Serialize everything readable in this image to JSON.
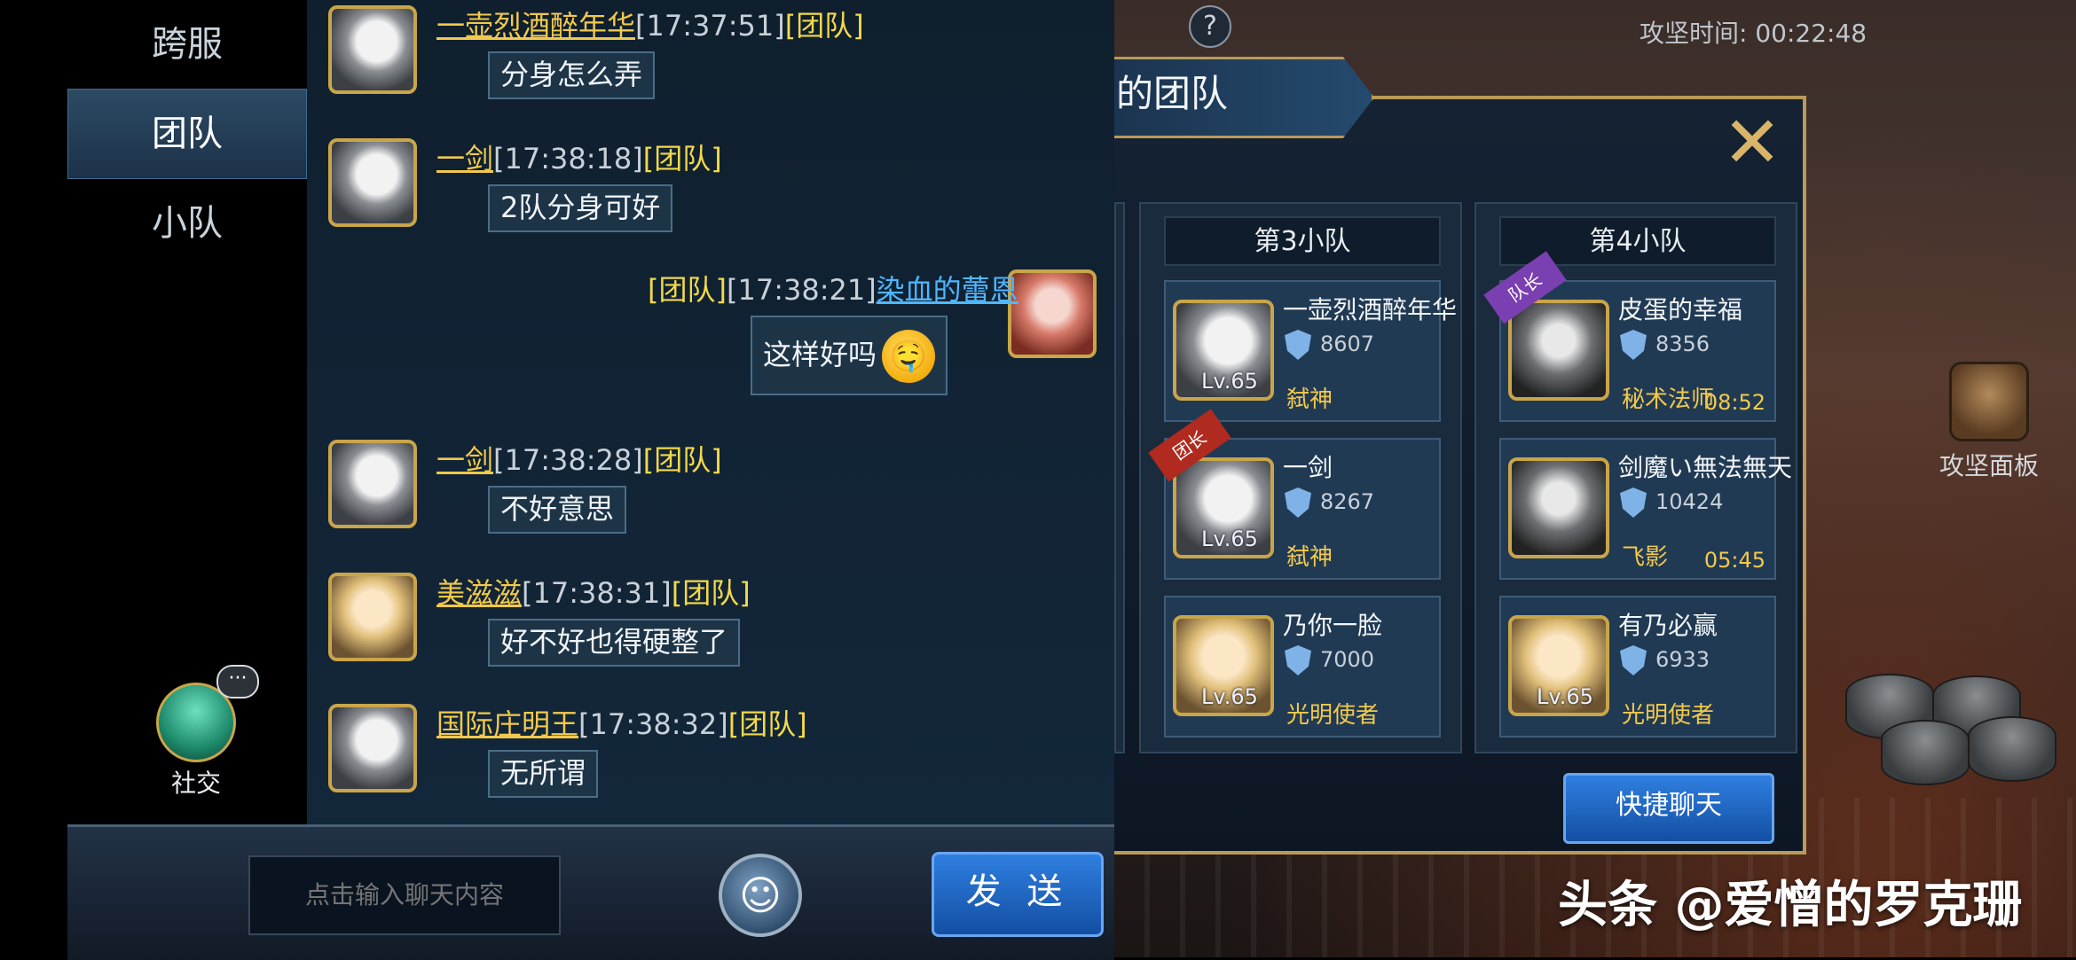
{
  "side_tabs": [
    "跨服",
    "团队",
    "小队"
  ],
  "social": {
    "label": "社交",
    "bubble": "···"
  },
  "top": {
    "siege_time": "攻坚时间: 00:22:48",
    "siege_panel": "攻坚面板"
  },
  "chat": {
    "messages": [
      {
        "name": "一壶烈酒醉年华",
        "time": "[17:37:51]",
        "channel": "[团队]",
        "text": "分身怎么弄"
      },
      {
        "name": "一剑",
        "time": "[17:38:18]",
        "channel": "[团队]",
        "text": "2队分身可好"
      },
      {
        "name": "染血的蕾恩",
        "time": "[17:38:21]",
        "channel": "[团队]",
        "text": "这样好吗",
        "emoji": "🤤"
      },
      {
        "name": "一剑",
        "time": "[17:38:28]",
        "channel": "[团队]",
        "text": "不好意思"
      },
      {
        "name": "美滋滋",
        "time": "[17:38:31]",
        "channel": "[团队]",
        "text": "好不好也得硬整了"
      },
      {
        "name": "国际庄明王",
        "time": "[17:38:32]",
        "channel": "[团队]",
        "text": "无所谓"
      }
    ],
    "input_placeholder": "点击输入聊天内容",
    "send_label": "发 送",
    "emoji_button": "☺"
  },
  "team": {
    "title": "的团队",
    "close": "✕",
    "squads": [
      {
        "header": "第3小队",
        "members": [
          {
            "name": "一壶烈酒醉年华",
            "level": "Lv.65",
            "power": "8607",
            "class": "弑神"
          },
          {
            "name": "一剑",
            "level": "Lv.65",
            "power": "8267",
            "class": "弑神",
            "ribbon": "团长"
          },
          {
            "name": "乃你一脸",
            "level": "Lv.65",
            "power": "7000",
            "class": "光明使者"
          }
        ]
      },
      {
        "header": "第4小队",
        "members": [
          {
            "name": "皮蛋的幸福",
            "power": "8356",
            "class": "秘术法师",
            "timer": "08:52",
            "ribbon": "队长"
          },
          {
            "name": "剑魔い無法無天",
            "power": "10424",
            "class": "飞影",
            "timer": "05:45"
          },
          {
            "name": "有乃必赢",
            "level": "Lv.65",
            "power": "6933",
            "class": "光明使者"
          }
        ]
      }
    ],
    "quick_chat": "快捷聊天"
  },
  "watermark": "头条 @爱憎的罗克珊",
  "colors": {
    "name": "#f2c94c",
    "self_name": "#4fb7ff",
    "channel": "#f2d94a",
    "button": "#2f7fe0"
  }
}
